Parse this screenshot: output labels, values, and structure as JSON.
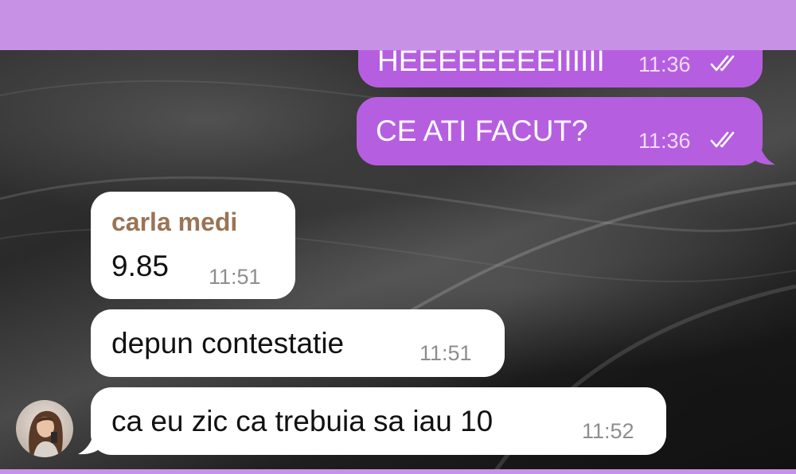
{
  "messages": [
    {
      "direction": "outgoing",
      "text": "HEEEEEEEEIIIIII",
      "time": "11:36",
      "status": "read"
    },
    {
      "direction": "outgoing",
      "text": "CE ATI FACUT?",
      "time": "11:36",
      "status": "read"
    },
    {
      "direction": "incoming",
      "sender": "carla medi",
      "text": "9.85",
      "time": "11:51"
    },
    {
      "direction": "incoming",
      "text": "depun contestatie",
      "time": "11:51"
    },
    {
      "direction": "incoming",
      "text": "ca eu zic ca trebuia sa iau 10",
      "time": "11:52"
    }
  ],
  "colors": {
    "header": "#c792e6",
    "outgoing_bubble": "#b65ee0",
    "incoming_bubble": "#ffffff",
    "sender_name": "#9b7355"
  },
  "icons": {
    "read_status": "double-check-icon",
    "avatar": "avatar"
  }
}
